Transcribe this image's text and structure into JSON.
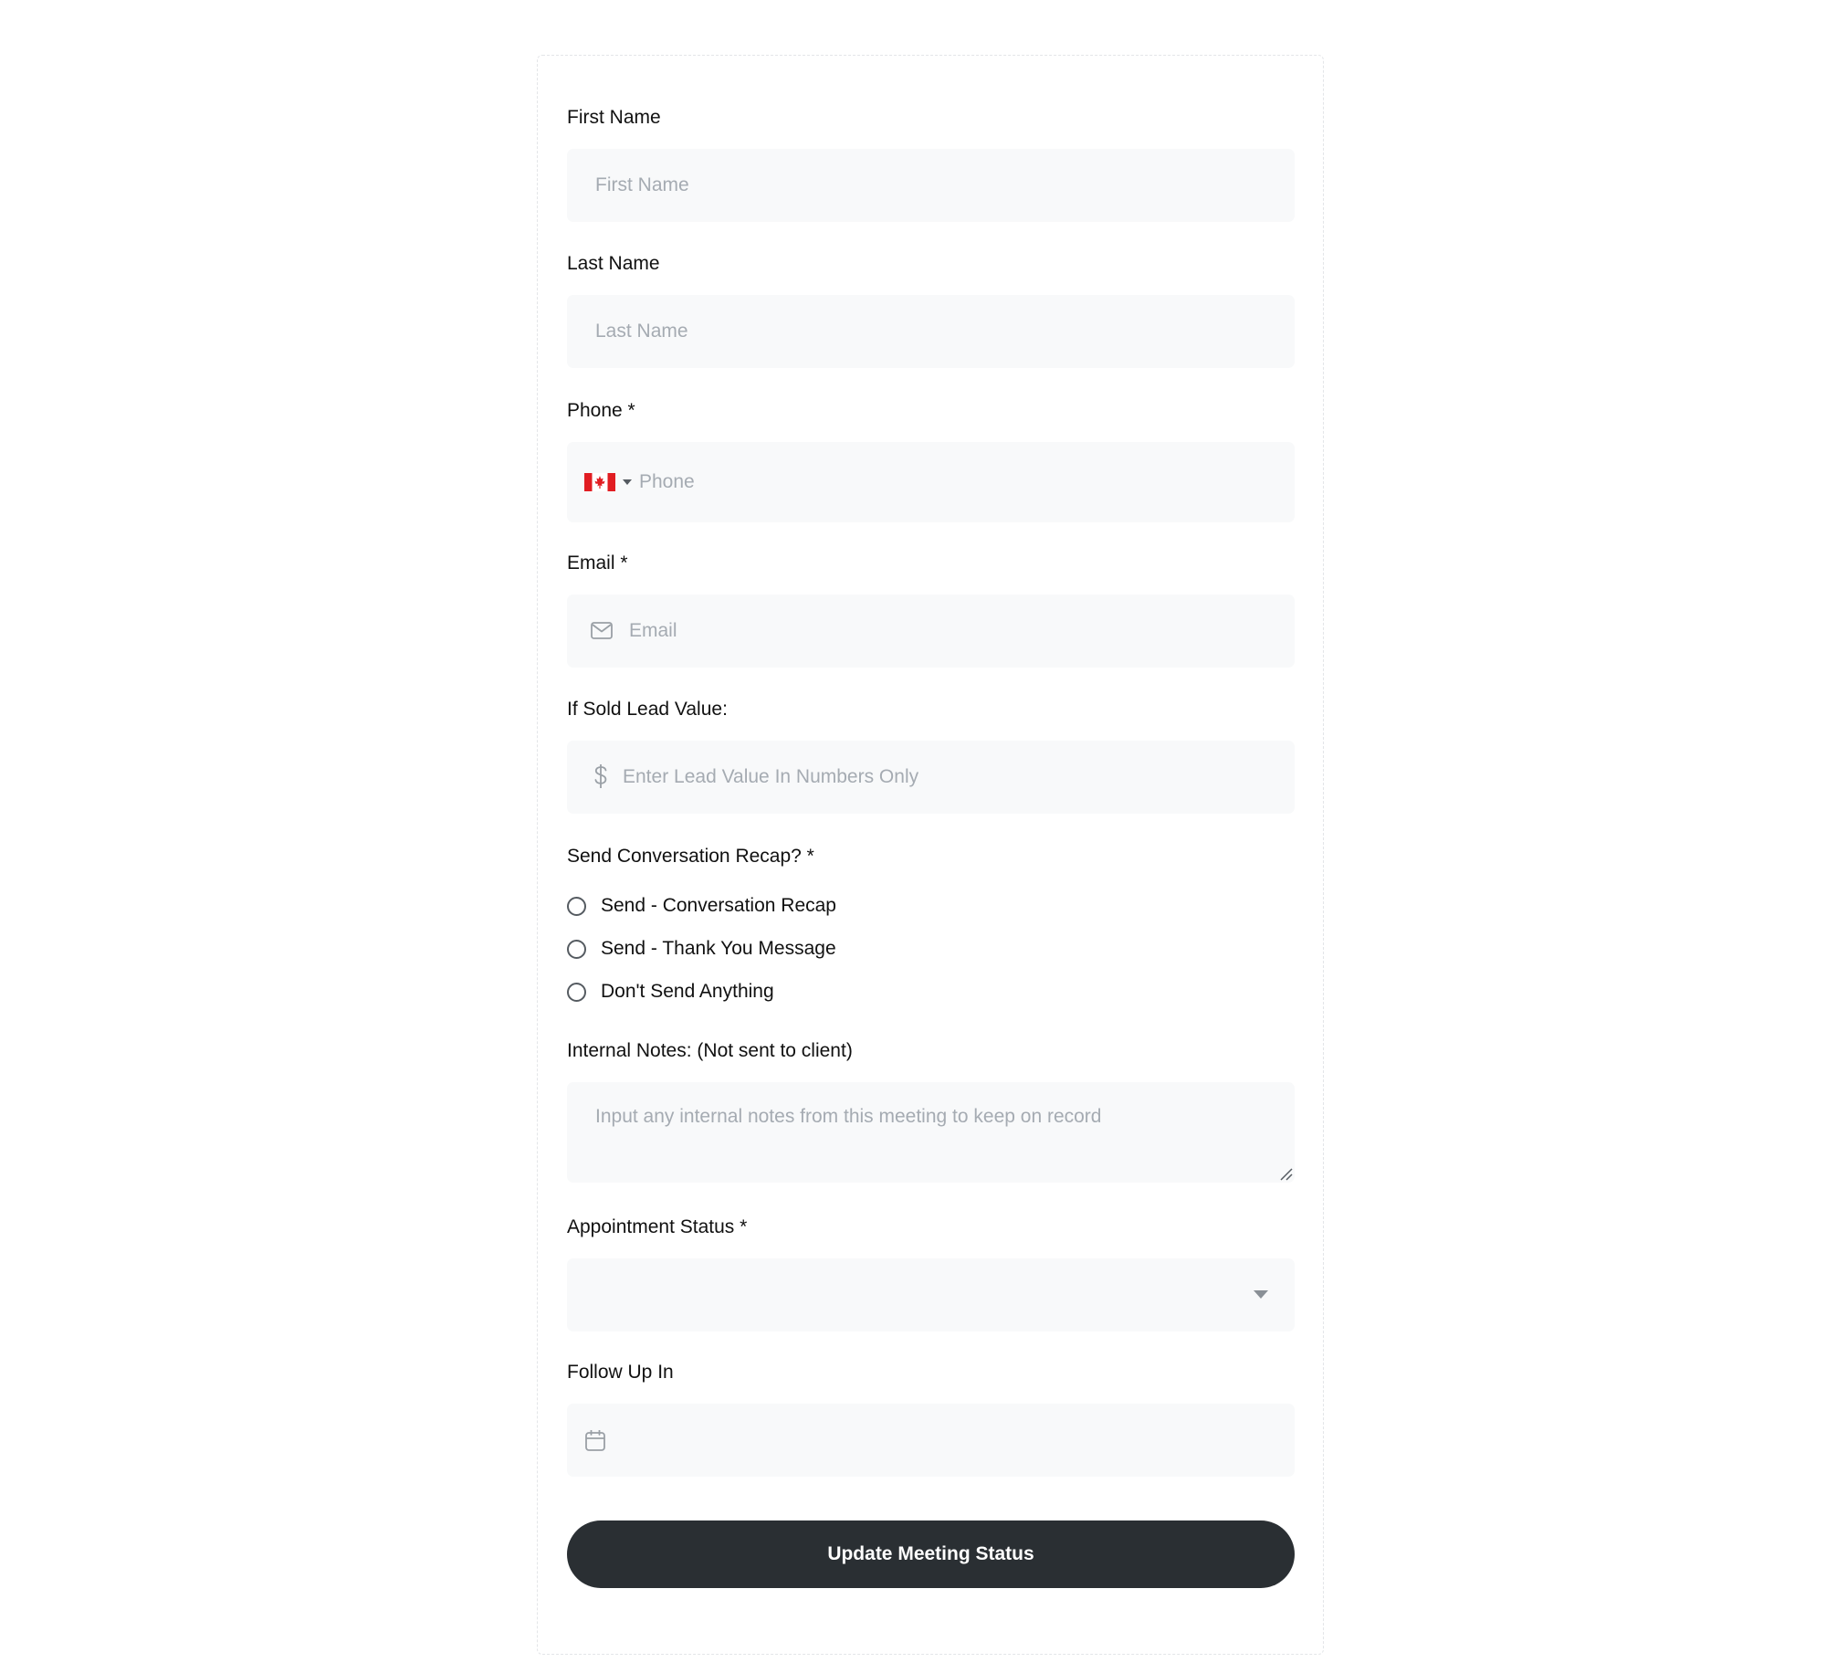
{
  "form": {
    "first_name": {
      "label": "First Name",
      "placeholder": "First Name"
    },
    "last_name": {
      "label": "Last Name",
      "placeholder": "Last Name"
    },
    "phone": {
      "label": "Phone *",
      "placeholder": "Phone",
      "country_flag_icon": "canada-flag-icon"
    },
    "email": {
      "label": "Email *",
      "placeholder": "Email",
      "icon": "envelope-icon"
    },
    "lead_value": {
      "label": "If Sold Lead Value:",
      "placeholder": "Enter Lead Value In Numbers Only",
      "icon": "dollar-icon"
    },
    "recap": {
      "label": "Send Conversation Recap? *",
      "options": [
        "Send - Conversation Recap",
        "Send - Thank You Message",
        "Don't Send Anything"
      ]
    },
    "internal_notes": {
      "label": "Internal Notes: (Not sent to client)",
      "placeholder": "Input any internal notes from this meeting to keep on record"
    },
    "appointment_status": {
      "label": "Appointment Status *",
      "value": ""
    },
    "follow_up": {
      "label": "Follow Up In",
      "icon": "calendar-icon"
    },
    "submit_label": "Update Meeting Status"
  },
  "colors": {
    "field_background": "#f8f9fa",
    "placeholder": "#a5abb2",
    "button_background": "#2a2f33",
    "button_text": "#ffffff",
    "card_border": "#e3e5e8",
    "flag_red": "#e11d22"
  }
}
